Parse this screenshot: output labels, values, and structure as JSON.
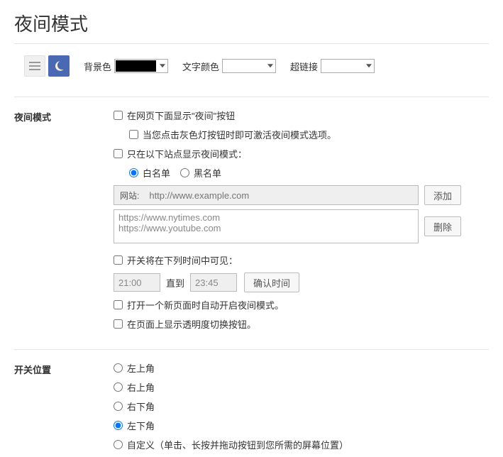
{
  "title": "夜间模式",
  "toolbar": {
    "bg_label": "背景色",
    "text_label": "文字颜色",
    "link_label": "超链接",
    "bg_color": "#000000",
    "text_color": "#ffffff",
    "link_color": "#ffffff"
  },
  "night": {
    "section_label": "夜间模式",
    "show_btn": "在网页下面显示\"夜间\"按钮",
    "gray_hint": "当您点击灰色灯按钮时即可激活夜间模式选项。",
    "only_sites": "只在以下站点显示夜间模式：",
    "whitelist": "白名单",
    "blacklist": "黑名单",
    "site_lbl": "网站:",
    "site_placeholder": "http://www.example.com",
    "add_btn": "添加",
    "del_btn": "删除",
    "sites_list": "https://www.nytimes.com\nhttps://www.youtube.com",
    "time_visible": "开关将在下列时间中可见：",
    "time_from": "21:00",
    "time_word": "直到",
    "time_to": "23:45",
    "confirm_time": "确认时间",
    "auto_on": "打开一个新页面时自动开启夜间模式。",
    "opacity_btn": "在页面上显示透明度切换按钮。"
  },
  "position": {
    "section_label": "开关位置",
    "tl": "左上角",
    "tr": "右上角",
    "br": "右下角",
    "bl": "左下角",
    "custom": "自定义（单击、长按并拖动按钮到您所需的屏幕位置）"
  }
}
